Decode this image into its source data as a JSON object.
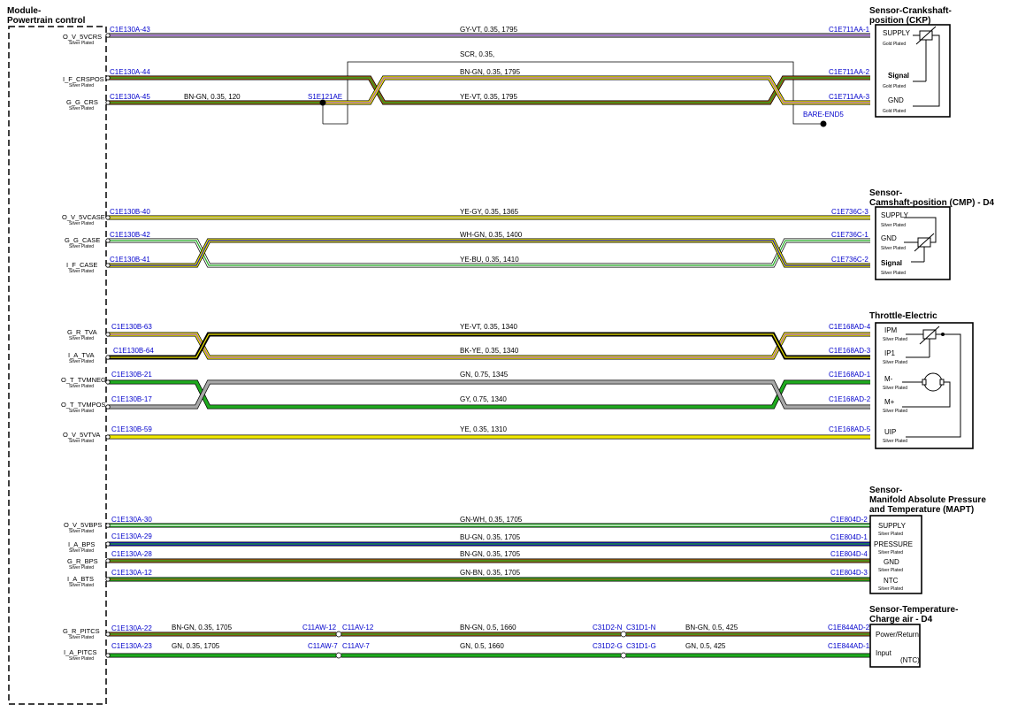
{
  "module": {
    "title_line1": "Module-",
    "title_line2": "Powertrain control"
  },
  "plating": {
    "silver": "Silver Plated",
    "gold": "Gold Plated"
  },
  "colors": {
    "GY": "#a8a8a8",
    "VT": "#9a58d6",
    "BN": "#a05a14",
    "GN": "#1faa1f",
    "YE": "#f2ea00",
    "WH": "#ffffff",
    "BU": "#1414c8",
    "BK": "#000000",
    "connector_label": "#0000cc"
  },
  "wires": [
    {
      "id": "w1",
      "pin": "O_V_5VCRS",
      "left_conn": "C1E130A-43",
      "spec": "GY-VT, 0.35, 1795",
      "right_conn": "C1E711AA-1",
      "colors": [
        "GY",
        "VT"
      ]
    },
    {
      "id": "w2",
      "pin": "I_F_CRSPOS",
      "left_conn": "C1E130A-44",
      "spec": "BN-GN, 0.35, 1795",
      "right_conn": "C1E711AA-2",
      "colors": [
        "BN",
        "GN"
      ]
    },
    {
      "id": "w3",
      "pin": "G_G_CRS",
      "left_conn": "C1E130A-45",
      "spec_left": "BN-GN, 0.35, 120",
      "splice": "S1E121AE",
      "spec": "YE-VT, 0.35, 1795",
      "right_conn": "C1E711AA-3",
      "colors": [
        "YE",
        "VT"
      ]
    },
    {
      "id": "w4",
      "pin": "O_V_5VCASE",
      "left_conn": "C1E130B-40",
      "spec": "YE-GY, 0.35, 1365",
      "right_conn": "C1E736C-3",
      "colors": [
        "YE",
        "GY"
      ]
    },
    {
      "id": "w5",
      "pin": "G_G_CASE",
      "left_conn": "C1E130B-42",
      "spec": "WH-GN, 0.35, 1400",
      "right_conn": "C1E736C-1",
      "colors": [
        "WH",
        "GN"
      ]
    },
    {
      "id": "w6",
      "pin": "I_F_CASE",
      "left_conn": "C1E130B-41",
      "spec": "YE-BU, 0.35, 1410",
      "right_conn": "C1E736C-2",
      "colors": [
        "YE",
        "BU"
      ]
    },
    {
      "id": "w7",
      "pin": "G_R_TVA",
      "left_conn": "C1E130B-63",
      "spec": "YE-VT, 0.35, 1340",
      "right_conn": "C1E168AD-4",
      "colors": [
        "YE",
        "VT"
      ]
    },
    {
      "id": "w8",
      "pin": "I_A_TVA",
      "left_conn": "C1E130B-64",
      "spec": "BK-YE, 0.35, 1340",
      "right_conn": "C1E168AD-3",
      "colors": [
        "BK",
        "YE"
      ]
    },
    {
      "id": "w9",
      "pin": "O_T_TVMNEG",
      "left_conn": "C1E130B-21",
      "spec": "GN, 0.75, 1345",
      "right_conn": "C1E168AD-1",
      "colors": [
        "GN"
      ]
    },
    {
      "id": "w10",
      "pin": "O_T_TVMPOS",
      "left_conn": "C1E130B-17",
      "spec": "GY, 0.75, 1340",
      "right_conn": "C1E168AD-2",
      "colors": [
        "GY"
      ]
    },
    {
      "id": "w11",
      "pin": "O_V_5VTVA",
      "left_conn": "C1E130B-59",
      "spec": "YE, 0.35, 1310",
      "right_conn": "C1E168AD-5",
      "colors": [
        "YE"
      ]
    },
    {
      "id": "w12",
      "pin": "O_V_5VBPS",
      "left_conn": "C1E130A-30",
      "spec": "GN-WH, 0.35, 1705",
      "right_conn": "C1E804D-2",
      "colors": [
        "GN",
        "WH"
      ]
    },
    {
      "id": "w13",
      "pin": "I_A_BPS",
      "left_conn": "C1E130A-29",
      "spec": "BU-GN, 0.35, 1705",
      "right_conn": "C1E804D-1",
      "colors": [
        "BU",
        "GN"
      ]
    },
    {
      "id": "w14",
      "pin": "G_R_BPS",
      "left_conn": "C1E130A-28",
      "spec": "BN-GN, 0.35, 1705",
      "right_conn": "C1E804D-4",
      "colors": [
        "BN",
        "GN"
      ]
    },
    {
      "id": "w15",
      "pin": "I_A_BTS",
      "left_conn": "C1E130A-12",
      "spec": "GN-BN, 0.35, 1705",
      "right_conn": "C1E804D-3",
      "colors": [
        "GN",
        "BN"
      ]
    },
    {
      "id": "w16",
      "pin": "G_R_PITCS",
      "left_conn": "C1E130A-22",
      "spec_a": "BN-GN, 0.35, 1705",
      "inline1_left": "C11AW-12",
      "inline1_right": "C11AV-12",
      "spec_b": "BN-GN, 0.5, 1660",
      "inline2_left": "C31D2-N",
      "inline2_right": "C31D1-N",
      "spec_c": "BN-GN, 0.5, 425",
      "right_conn": "C1E844AD-2",
      "colors": [
        "BN",
        "GN"
      ]
    },
    {
      "id": "w17",
      "pin": "I_A_PITCS",
      "left_conn": "C1E130A-23",
      "spec_a": "GN, 0.35, 1705",
      "inline1_left": "C11AW-7",
      "inline1_right": "C11AV-7",
      "spec_b": "GN, 0.5, 1660",
      "inline2_left": "C31D2-G",
      "inline2_right": "C31D1-G",
      "spec_c": "GN, 0.5, 425",
      "right_conn": "C1E844AD-1",
      "colors": [
        "GN"
      ]
    }
  ],
  "shield": {
    "label": "SCR, 0.35,",
    "drain_end": "BARE-END5"
  },
  "components": {
    "ckp": {
      "title1": "Sensor-Crankshaft-",
      "title2": "position (CKP)",
      "pins": [
        "SUPPLY",
        "Signal",
        "GND"
      ]
    },
    "cmp": {
      "title1": "Sensor-",
      "title2": "Camshaft-position (CMP) - D4",
      "pins": [
        "SUPPLY",
        "GND",
        "Signal"
      ]
    },
    "tve": {
      "title1": "Throttle-Electric",
      "pins": [
        "IPM",
        "IP1",
        "M-",
        "M+",
        "UIP"
      ]
    },
    "mapt": {
      "title1": "Sensor-",
      "title2": "Manifold Absolute Pressure",
      "title3": "and Temperature (MAPT)",
      "pins": [
        "SUPPLY",
        "PRESSURE",
        "GND",
        "NTC"
      ]
    },
    "cat": {
      "title1": "Sensor-Temperature-",
      "title2": "Charge air - D4",
      "pins": [
        "Power/Return",
        "Input"
      ],
      "note": "(NTC)"
    }
  }
}
